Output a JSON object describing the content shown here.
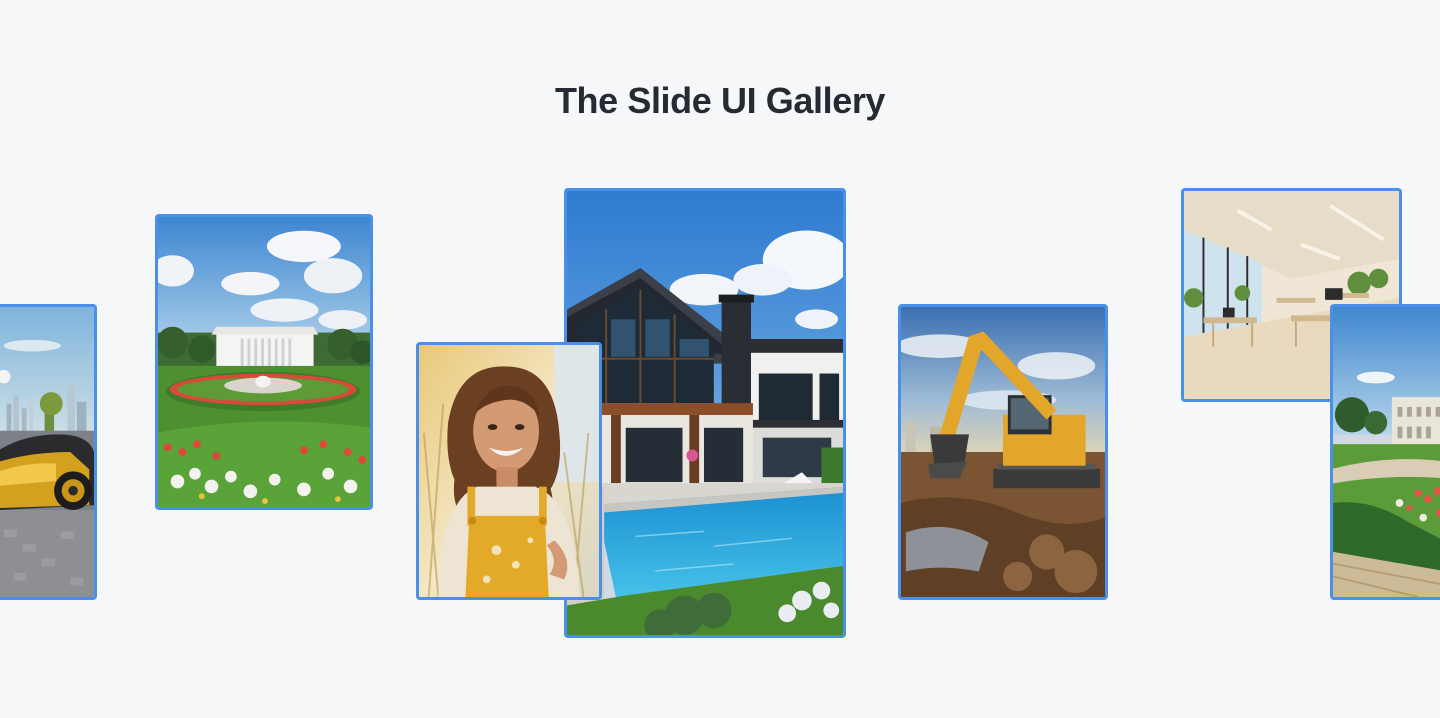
{
  "page": {
    "title": "The Slide UI Gallery"
  },
  "colors": {
    "background": "#f6f7f9",
    "title": "#272a33",
    "card_border": "#4a90e8"
  },
  "gallery": {
    "slides": [
      {
        "subject": "sports-car-city"
      },
      {
        "subject": "white-house-garden"
      },
      {
        "subject": "smiling-woman-overalls"
      },
      {
        "subject": "modern-house-pool"
      },
      {
        "subject": "excavator-construction"
      },
      {
        "subject": "modern-office-interior"
      },
      {
        "subject": "mansion-garden"
      }
    ]
  }
}
